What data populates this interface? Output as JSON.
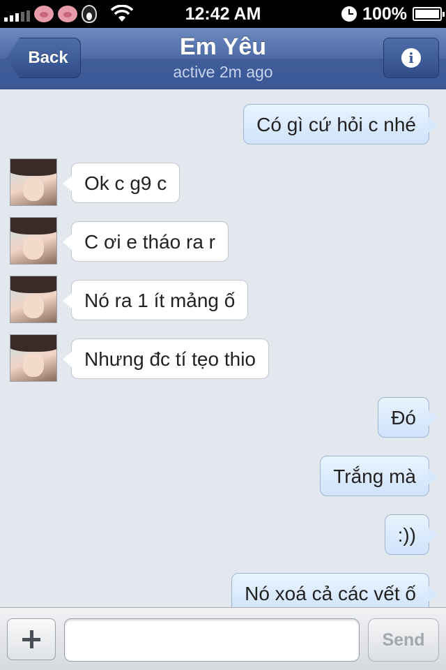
{
  "status_bar": {
    "time": "12:42 AM",
    "battery": "100%",
    "icons": [
      "signal-icon",
      "pig-icon",
      "pig-icon",
      "penguin-icon",
      "wifi-icon",
      "clock-icon",
      "battery-icon"
    ]
  },
  "nav": {
    "back_label": "Back",
    "title": "Em Yêu",
    "subtitle": "active 2m ago",
    "info_icon": "i"
  },
  "messages": [
    {
      "direction": "out",
      "text": "Có gì cứ hỏi c nhé"
    },
    {
      "direction": "in",
      "text": "Ok c g9 c"
    },
    {
      "direction": "in",
      "text": "C ơi e tháo ra r"
    },
    {
      "direction": "in",
      "text": "Nó ra 1 ít mảng ố"
    },
    {
      "direction": "in",
      "text": "Nhưng đc tí tẹo thio"
    },
    {
      "direction": "out",
      "text": "Đó"
    },
    {
      "direction": "out",
      "text": "Trắng mà"
    },
    {
      "direction": "out",
      "text": ":))"
    },
    {
      "direction": "out",
      "text": "Nó xoá cả các vết ố"
    }
  ],
  "composer": {
    "input_value": "",
    "input_placeholder": "",
    "send_label": "Send"
  },
  "colors": {
    "nav_bar": "#3b5897",
    "outgoing_bubble": "#d7e8fc",
    "incoming_bubble": "#ffffff",
    "background": "#e3e7ee"
  }
}
